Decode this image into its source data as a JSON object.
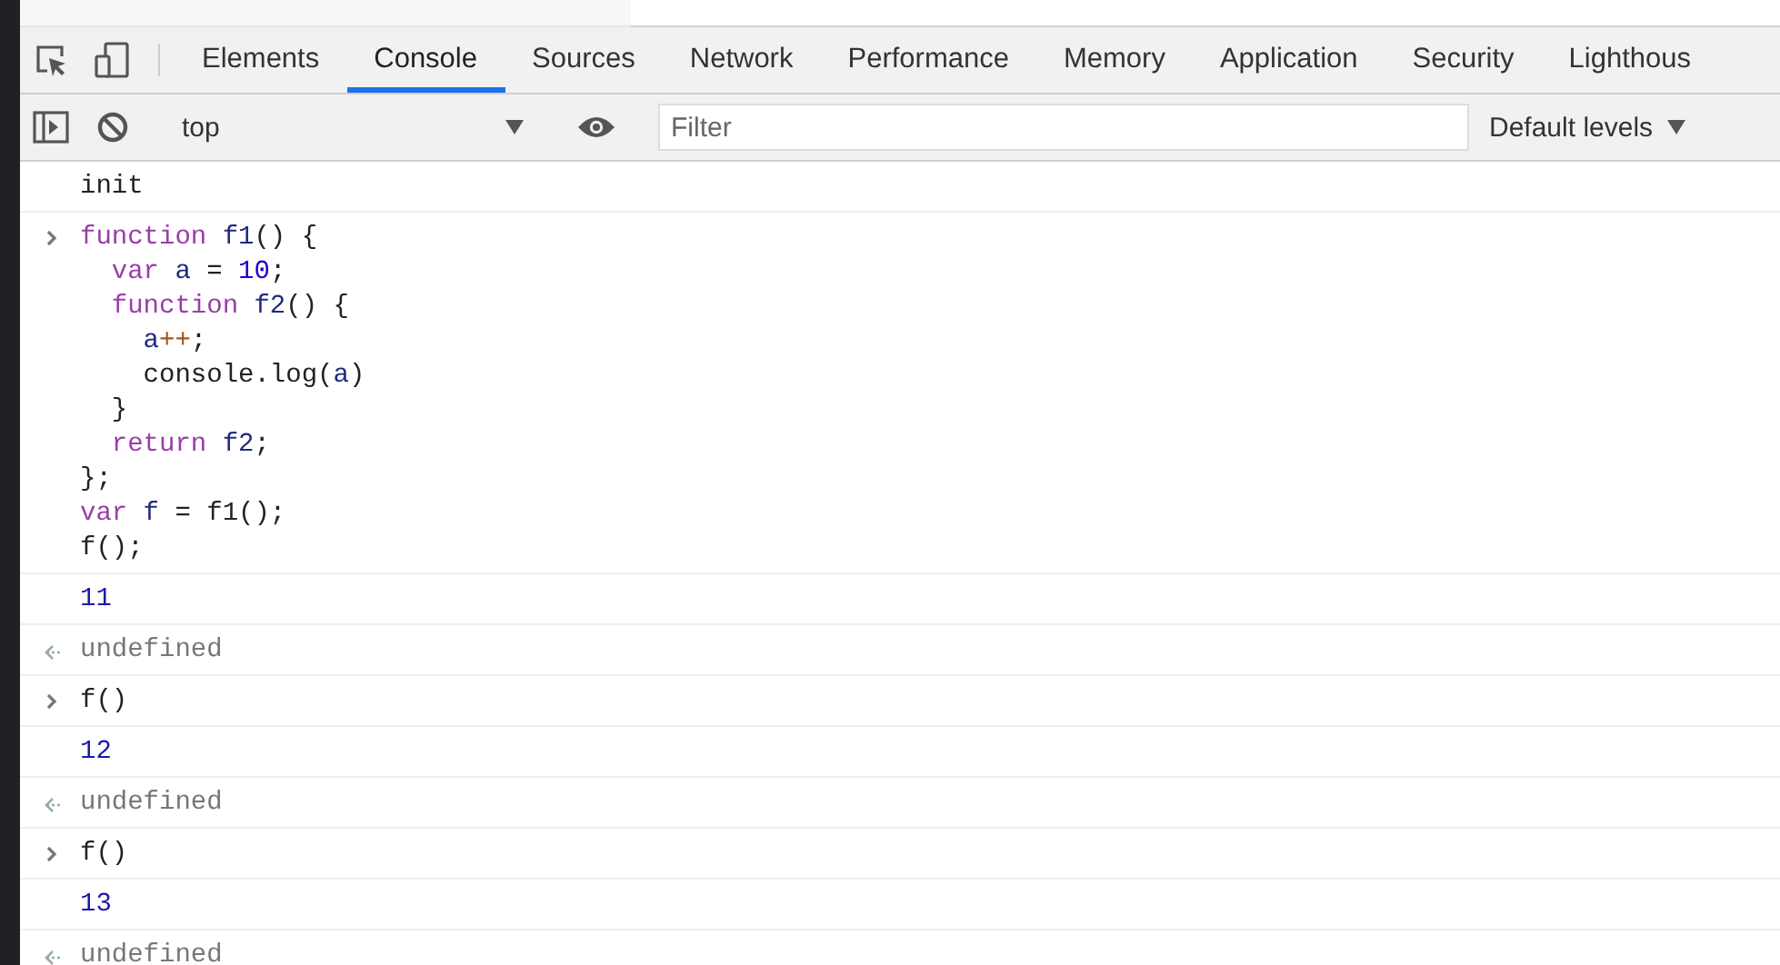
{
  "tabs": [
    {
      "label": "Elements",
      "selected": false
    },
    {
      "label": "Console",
      "selected": true
    },
    {
      "label": "Sources",
      "selected": false
    },
    {
      "label": "Network",
      "selected": false
    },
    {
      "label": "Performance",
      "selected": false
    },
    {
      "label": "Memory",
      "selected": false
    },
    {
      "label": "Application",
      "selected": false
    },
    {
      "label": "Security",
      "selected": false
    },
    {
      "label": "Lighthous",
      "selected": false
    }
  ],
  "toolbar": {
    "context": "top",
    "filter": {
      "placeholder": "Filter"
    },
    "levels": "Default levels"
  },
  "entries": [
    {
      "kind": "log",
      "text": "init"
    },
    {
      "kind": "input",
      "lines": [
        [
          {
            "text": "function",
            "kind": "keyword"
          },
          {
            "text": " f1",
            "kind": "name"
          },
          {
            "text": "() {",
            "kind": "plain"
          }
        ],
        [
          {
            "text": "  var",
            "kind": "keyword"
          },
          {
            "text": " a",
            "kind": "name"
          },
          {
            "text": " = ",
            "kind": "plain"
          },
          {
            "text": "10",
            "kind": "number"
          },
          {
            "text": ";",
            "kind": "plain"
          }
        ],
        [
          {
            "text": "  function",
            "kind": "keyword"
          },
          {
            "text": " f2",
            "kind": "name"
          },
          {
            "text": "() {",
            "kind": "plain"
          }
        ],
        [
          {
            "text": "    a",
            "kind": "name"
          },
          {
            "text": "++",
            "kind": "operator"
          },
          {
            "text": ";",
            "kind": "plain"
          }
        ],
        [
          {
            "text": "    console.log(",
            "kind": "plain"
          },
          {
            "text": "a",
            "kind": "name"
          },
          {
            "text": ")",
            "kind": "plain"
          }
        ],
        [
          {
            "text": "  }",
            "kind": "plain"
          }
        ],
        [
          {
            "text": "  return",
            "kind": "keyword"
          },
          {
            "text": " f2",
            "kind": "name"
          },
          {
            "text": ";",
            "kind": "plain"
          }
        ],
        [
          {
            "text": "};",
            "kind": "plain"
          }
        ],
        [
          {
            "text": "var",
            "kind": "keyword"
          },
          {
            "text": " f",
            "kind": "name"
          },
          {
            "text": " = f1();",
            "kind": "plain"
          }
        ],
        [
          {
            "text": "f();",
            "kind": "plain"
          }
        ]
      ]
    },
    {
      "kind": "number",
      "text": "11"
    },
    {
      "kind": "result",
      "text": "undefined"
    },
    {
      "kind": "input",
      "lines": [
        [
          {
            "text": "f()",
            "kind": "plain"
          }
        ]
      ]
    },
    {
      "kind": "number",
      "text": "12"
    },
    {
      "kind": "result",
      "text": "undefined"
    },
    {
      "kind": "input",
      "lines": [
        [
          {
            "text": "f()",
            "kind": "plain"
          }
        ]
      ]
    },
    {
      "kind": "number",
      "text": "13"
    },
    {
      "kind": "result",
      "text": "undefined"
    }
  ]
}
